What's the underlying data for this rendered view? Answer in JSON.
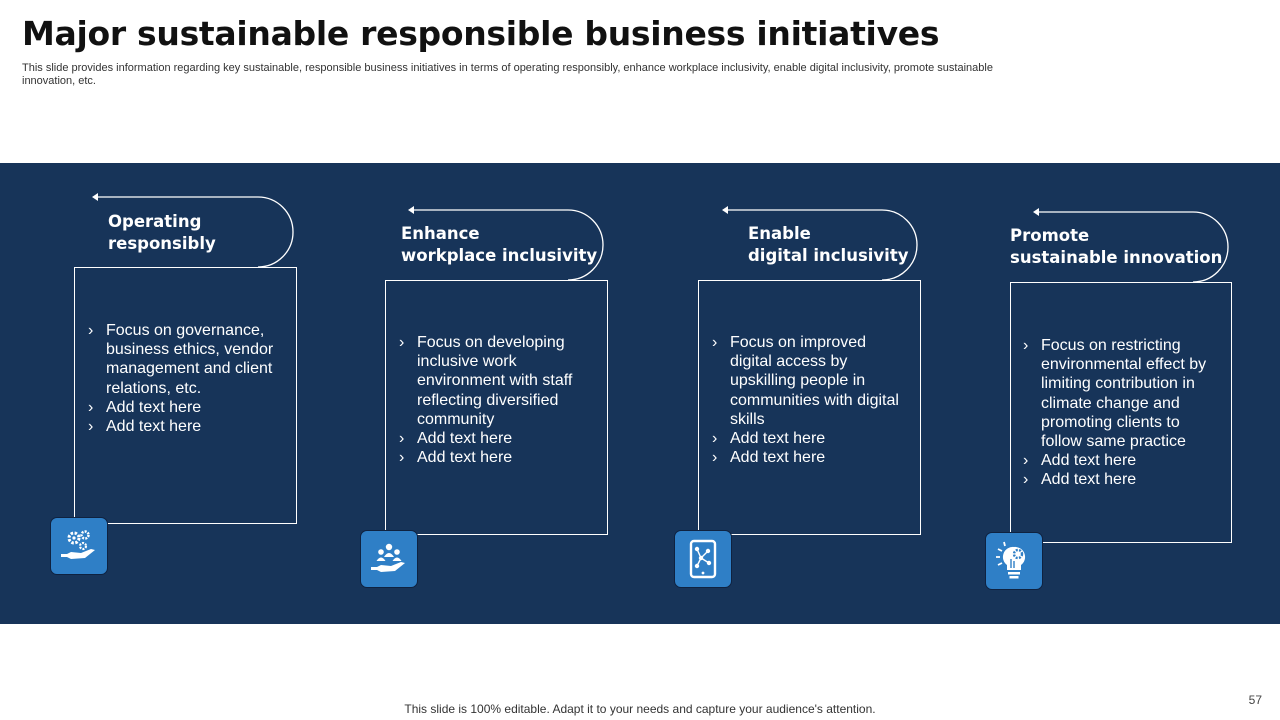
{
  "slide": {
    "title": "Major sustainable responsible business initiatives",
    "subtitle": "This slide provides information regarding key sustainable, responsible business initiatives in terms of operating responsibly, enhance workplace inclusivity, enable digital inclusivity, promote sustainable innovation, etc.",
    "footer": "This slide is 100% editable. Adapt it to your needs and capture your audience's attention.",
    "page_number": "57"
  },
  "cards": [
    {
      "heading_line1": "Operating",
      "heading_line2": "responsibly",
      "bullets": [
        "Focus on governance, business ethics, vendor management and client relations, etc.",
        "Add text here",
        "Add text here"
      ],
      "icon": "hand-gears-icon"
    },
    {
      "heading_line1": "Enhance",
      "heading_line2": "workplace inclusivity",
      "bullets": [
        "Focus on developing inclusive work environment with staff reflecting diversified community",
        "Add text here",
        "Add text here"
      ],
      "icon": "hand-people-icon"
    },
    {
      "heading_line1": "Enable",
      "heading_line2": "digital inclusivity",
      "bullets": [
        "Focus on improved digital access by upskilling people in communities with digital skills",
        "Add text here",
        "Add text here"
      ],
      "icon": "digital-tablet-network-icon"
    },
    {
      "heading_line1": "Promote",
      "heading_line2": "sustainable innovation",
      "bullets": [
        "Focus on restricting environmental effect by limiting contribution in climate change and promoting clients to follow same practice",
        "Add text here",
        "Add text here"
      ],
      "icon": "lightbulb-gear-icon"
    }
  ],
  "colors": {
    "band": "#173459",
    "icon_tile": "#2f7fc6",
    "text_light": "#ffffff",
    "title": "#111111"
  }
}
